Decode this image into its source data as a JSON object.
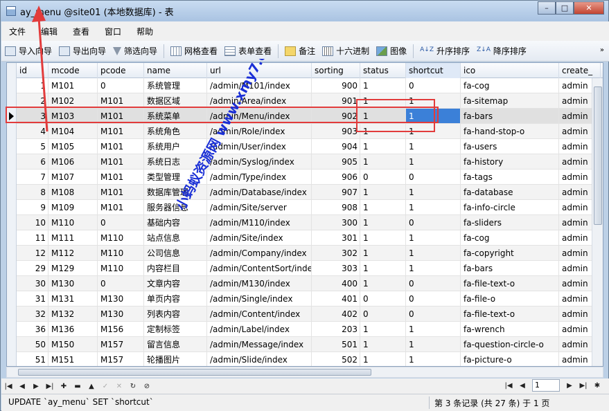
{
  "window": {
    "title": "ay_menu @site01 (本地数据库) - 表",
    "min": "–",
    "max": "□",
    "close": "✕"
  },
  "menu": [
    {
      "label": "文件"
    },
    {
      "label": "编辑"
    },
    {
      "label": "查看"
    },
    {
      "label": "窗口"
    },
    {
      "label": "帮助"
    }
  ],
  "toolbar": {
    "import_wizard": "导入向导",
    "export_wizard": "导出向导",
    "filter_wizard": "筛选向导",
    "grid_view": "网格查看",
    "form_view": "表单查看",
    "memo": "备注",
    "hex": "十六进制",
    "image": "图像",
    "sort_asc": "升序排序",
    "sort_desc": "降序排序",
    "sort_asc_glyph": "A↓Z",
    "sort_desc_glyph": "Z↓A",
    "more": "»"
  },
  "columns": [
    "id",
    "mcode",
    "pcode",
    "name",
    "url",
    "sorting",
    "status",
    "shortcut",
    "ico",
    "create_"
  ],
  "rows": [
    {
      "id": "1",
      "mcode": "M101",
      "pcode": "0",
      "name": "系统管理",
      "url": "/admin/M101/index",
      "sorting": "900",
      "status": "1",
      "shortcut": "0",
      "ico": "fa-cog",
      "create": "admin"
    },
    {
      "id": "2",
      "mcode": "M102",
      "pcode": "M101",
      "name": "数据区域",
      "url": "/admin/Area/index",
      "sorting": "901",
      "status": "1",
      "shortcut": "1",
      "ico": "fa-sitemap",
      "create": "admin"
    },
    {
      "id": "3",
      "mcode": "M103",
      "pcode": "M101",
      "name": "系统菜单",
      "url": "/admin/Menu/index",
      "sorting": "902",
      "status": "1",
      "shortcut": "1",
      "ico": "fa-bars",
      "create": "admin"
    },
    {
      "id": "4",
      "mcode": "M104",
      "pcode": "M101",
      "name": "系统角色",
      "url": "/admin/Role/index",
      "sorting": "903",
      "status": "1",
      "shortcut": "1",
      "ico": "fa-hand-stop-o",
      "create": "admin"
    },
    {
      "id": "5",
      "mcode": "M105",
      "pcode": "M101",
      "name": "系统用户",
      "url": "/admin/User/index",
      "sorting": "904",
      "status": "1",
      "shortcut": "1",
      "ico": "fa-users",
      "create": "admin"
    },
    {
      "id": "6",
      "mcode": "M106",
      "pcode": "M101",
      "name": "系统日志",
      "url": "/admin/Syslog/index",
      "sorting": "905",
      "status": "1",
      "shortcut": "1",
      "ico": "fa-history",
      "create": "admin"
    },
    {
      "id": "7",
      "mcode": "M107",
      "pcode": "M101",
      "name": "类型管理",
      "url": "/admin/Type/index",
      "sorting": "906",
      "status": "0",
      "shortcut": "0",
      "ico": "fa-tags",
      "create": "admin"
    },
    {
      "id": "8",
      "mcode": "M108",
      "pcode": "M101",
      "name": "数据库管理",
      "url": "/admin/Database/index",
      "sorting": "907",
      "status": "1",
      "shortcut": "1",
      "ico": "fa-database",
      "create": "admin"
    },
    {
      "id": "9",
      "mcode": "M109",
      "pcode": "M101",
      "name": "服务器信息",
      "url": "/admin/Site/server",
      "sorting": "908",
      "status": "1",
      "shortcut": "1",
      "ico": "fa-info-circle",
      "create": "admin"
    },
    {
      "id": "10",
      "mcode": "M110",
      "pcode": "0",
      "name": "基础内容",
      "url": "/admin/M110/index",
      "sorting": "300",
      "status": "1",
      "shortcut": "0",
      "ico": "fa-sliders",
      "create": "admin"
    },
    {
      "id": "11",
      "mcode": "M111",
      "pcode": "M110",
      "name": "站点信息",
      "url": "/admin/Site/index",
      "sorting": "301",
      "status": "1",
      "shortcut": "1",
      "ico": "fa-cog",
      "create": "admin"
    },
    {
      "id": "12",
      "mcode": "M112",
      "pcode": "M110",
      "name": "公司信息",
      "url": "/admin/Company/index",
      "sorting": "302",
      "status": "1",
      "shortcut": "1",
      "ico": "fa-copyright",
      "create": "admin"
    },
    {
      "id": "29",
      "mcode": "M129",
      "pcode": "M110",
      "name": "内容栏目",
      "url": "/admin/ContentSort/inde",
      "sorting": "303",
      "status": "1",
      "shortcut": "1",
      "ico": "fa-bars",
      "create": "admin"
    },
    {
      "id": "30",
      "mcode": "M130",
      "pcode": "0",
      "name": "文章内容",
      "url": "/admin/M130/index",
      "sorting": "400",
      "status": "1",
      "shortcut": "0",
      "ico": "fa-file-text-o",
      "create": "admin"
    },
    {
      "id": "31",
      "mcode": "M131",
      "pcode": "M130",
      "name": "单页内容",
      "url": "/admin/Single/index",
      "sorting": "401",
      "status": "0",
      "shortcut": "0",
      "ico": "fa-file-o",
      "create": "admin"
    },
    {
      "id": "32",
      "mcode": "M132",
      "pcode": "M130",
      "name": "列表内容",
      "url": "/admin/Content/index",
      "sorting": "402",
      "status": "0",
      "shortcut": "0",
      "ico": "fa-file-text-o",
      "create": "admin"
    },
    {
      "id": "36",
      "mcode": "M136",
      "pcode": "M156",
      "name": "定制标签",
      "url": "/admin/Label/index",
      "sorting": "203",
      "status": "1",
      "shortcut": "1",
      "ico": "fa-wrench",
      "create": "admin"
    },
    {
      "id": "50",
      "mcode": "M150",
      "pcode": "M157",
      "name": "留言信息",
      "url": "/admin/Message/index",
      "sorting": "501",
      "status": "1",
      "shortcut": "1",
      "ico": "fa-question-circle-o",
      "create": "admin"
    },
    {
      "id": "51",
      "mcode": "M151",
      "pcode": "M157",
      "name": "轮播图片",
      "url": "/admin/Slide/index",
      "sorting": "502",
      "status": "1",
      "shortcut": "1",
      "ico": "fa-picture-o",
      "create": "admin"
    }
  ],
  "nav": {
    "page": "1"
  },
  "status": {
    "sql": "UPDATE `ay_menu` SET `shortcut`",
    "record": "第 3 条记录 (共 27 条) 于 1 页"
  },
  "watermark": "小蚂蚁资源网 www.xmy7.com",
  "colors": {
    "accent": "#3b80d8",
    "annotation": "#e23b3b",
    "watermark": "#1a2fd6"
  }
}
